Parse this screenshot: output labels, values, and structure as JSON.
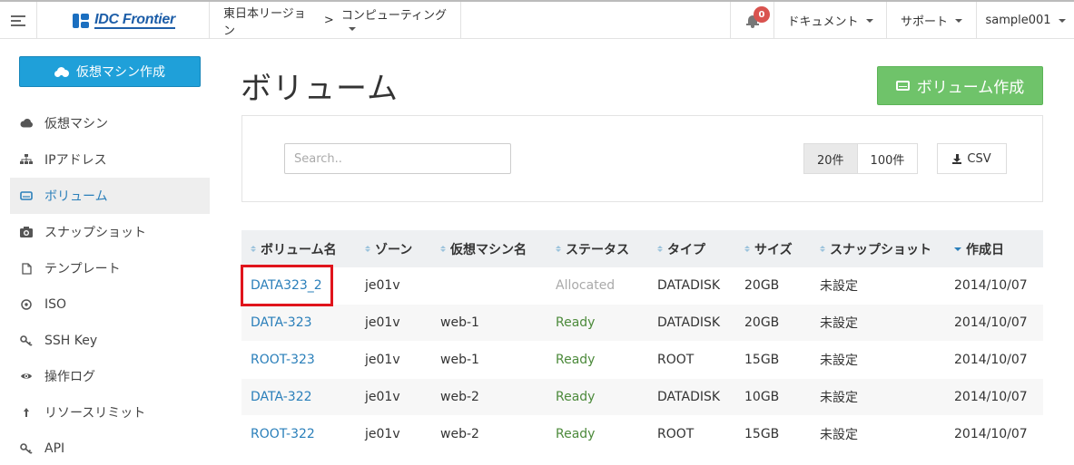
{
  "topbar": {
    "logo_text": "IDC Frontier",
    "region": "東日本リージョン",
    "region_sep": ">",
    "service": "コンピューティング",
    "notification_count": "0",
    "docs": "ドキュメント",
    "support": "サポート",
    "user": "sample001"
  },
  "sidebar": {
    "create_button": "仮想マシン作成",
    "items": [
      {
        "label": "仮想マシン",
        "icon": "cloud-icon"
      },
      {
        "label": "IPアドレス",
        "icon": "sitemap-icon"
      },
      {
        "label": "ボリューム",
        "icon": "hdd-icon",
        "active": true
      },
      {
        "label": "スナップショット",
        "icon": "camera-icon"
      },
      {
        "label": "テンプレート",
        "icon": "file-icon"
      },
      {
        "label": "ISO",
        "icon": "disc-icon"
      },
      {
        "label": "SSH Key",
        "icon": "key-icon"
      },
      {
        "label": "操作ログ",
        "icon": "eye-icon"
      },
      {
        "label": "リソースリミット",
        "icon": "arrow-up-icon"
      },
      {
        "label": "API",
        "icon": "key-icon"
      }
    ]
  },
  "main": {
    "title": "ボリューム",
    "create_button": "ボリューム作成",
    "search_placeholder": "Search..",
    "per_page": [
      "20件",
      "100件"
    ],
    "per_page_selected": 0,
    "csv_label": "CSV"
  },
  "table": {
    "columns": [
      "ボリューム名",
      "ゾーン",
      "仮想マシン名",
      "ステータス",
      "タイプ",
      "サイズ",
      "スナップショット",
      "作成日"
    ],
    "rows": [
      {
        "name": "DATA323_2",
        "zone": "je01v",
        "vm": "",
        "status": "Allocated",
        "type": "DATADISK",
        "size": "20GB",
        "snapshot": "未設定",
        "created": "2014/10/07"
      },
      {
        "name": "DATA-323",
        "zone": "je01v",
        "vm": "web-1",
        "status": "Ready",
        "type": "DATADISK",
        "size": "20GB",
        "snapshot": "未設定",
        "created": "2014/10/07"
      },
      {
        "name": "ROOT-323",
        "zone": "je01v",
        "vm": "web-1",
        "status": "Ready",
        "type": "ROOT",
        "size": "15GB",
        "snapshot": "未設定",
        "created": "2014/10/07"
      },
      {
        "name": "DATA-322",
        "zone": "je01v",
        "vm": "web-2",
        "status": "Ready",
        "type": "DATADISK",
        "size": "10GB",
        "snapshot": "未設定",
        "created": "2014/10/07"
      },
      {
        "name": "ROOT-322",
        "zone": "je01v",
        "vm": "web-2",
        "status": "Ready",
        "type": "ROOT",
        "size": "15GB",
        "snapshot": "未設定",
        "created": "2014/10/07"
      }
    ]
  },
  "colors": {
    "primary": "#1fa0d9",
    "success": "#6fc36a",
    "link": "#2a7fba",
    "ready": "#4c8a3b",
    "highlight": "#e0141c"
  }
}
